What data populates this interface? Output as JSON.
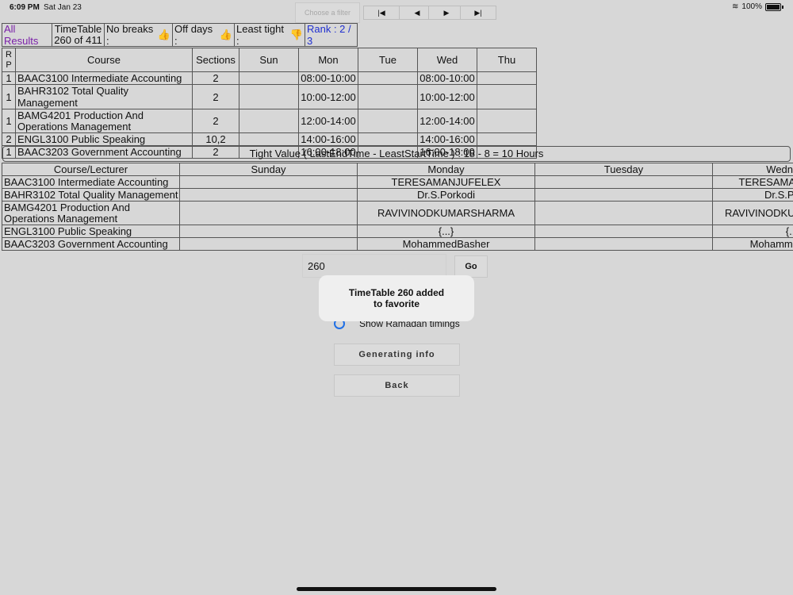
{
  "status": {
    "time": "6:09 PM",
    "date": "Sat Jan 23",
    "battery": "100%"
  },
  "toolbar": {
    "filter_placeholder": "Choose a filter",
    "nav": [
      "|◀",
      "◀",
      "▶",
      "▶|"
    ]
  },
  "summary": {
    "all_results": "All Results",
    "timetable_line1": "TimeTable",
    "timetable_line2": "260 of 411",
    "no_breaks": "No breaks :",
    "off_days": "Off days :",
    "least_tight": "Least tight :",
    "rank": "Rank : 2 / 3",
    "thumb_up": "👍",
    "thumb_down": "👎"
  },
  "schedule": {
    "headers": [
      "R P",
      "Course",
      "Sections",
      "Sun",
      "Mon",
      "Tue",
      "Wed",
      "Thu"
    ],
    "rows": [
      [
        "1",
        "BAAC3100 Intermediate Accounting",
        "2",
        "",
        "08:00-10:00",
        "",
        "08:00-10:00",
        ""
      ],
      [
        "1",
        "BAHR3102 Total Quality Management",
        "2",
        "",
        "10:00-12:00",
        "",
        "10:00-12:00",
        ""
      ],
      [
        "1",
        "BAMG4201 Production And Operations Management",
        "2",
        "",
        "12:00-14:00",
        "",
        "12:00-14:00",
        ""
      ],
      [
        "2",
        "ENGL3100 Public Speaking",
        "10,2",
        "",
        "14:00-16:00",
        "",
        "14:00-16:00",
        ""
      ],
      [
        "1",
        "BAAC3203 Government Accounting",
        "2",
        "",
        "16:00-18:00",
        "",
        "16:00-18:00",
        ""
      ]
    ]
  },
  "tight_value": "Tight Value ( LastEndTime - LeastStartTime ) : 18 - 8 = 10 Hours",
  "lecturers": {
    "headers": [
      "Course/Lecturer",
      "Sunday",
      "Monday",
      "Tuesday",
      "Wednesday"
    ],
    "rows": [
      [
        "BAAC3100 Intermediate Accounting",
        "",
        "TERESAMANJUFELEX",
        "",
        "TERESAMANJUFELEX"
      ],
      [
        "BAHR3102 Total Quality Management",
        "",
        "Dr.S.Porkodi",
        "",
        "Dr.S.Porkodi"
      ],
      [
        "BAMG4201 Production And Operations Management",
        "",
        "RAVIVINODKUMARSHARMA",
        "",
        "RAVIVINODKUMARSHARMA"
      ],
      [
        "ENGL3100 Public Speaking",
        "",
        "{...}",
        "",
        "{...}"
      ],
      [
        "BAAC3203 Government Accounting",
        "",
        "MohammedBasher",
        "",
        "MohammedBasher"
      ]
    ]
  },
  "goto": {
    "value": "260",
    "go_label": "Go"
  },
  "toast": {
    "line1": "TimeTable 260 added",
    "line2": "to favorite"
  },
  "ramadan_label": "Show Ramadan timings",
  "buttons": {
    "generating": "Generating info",
    "back": "Back"
  }
}
